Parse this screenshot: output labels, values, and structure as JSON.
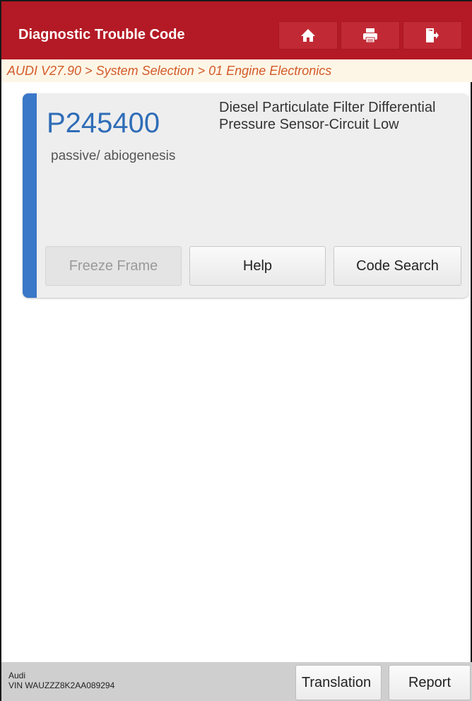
{
  "header": {
    "title": "Diagnostic Trouble Code",
    "buttons": [
      {
        "icon": "home-icon"
      },
      {
        "icon": "print-icon"
      },
      {
        "icon": "exit-icon"
      }
    ],
    "colors": {
      "bar": "#b41a25",
      "button": "#c12a35"
    }
  },
  "breadcrumb": {
    "text": "AUDI V27.90 > System Selection > 01 Engine Electronics"
  },
  "dtc": {
    "code": "P245400",
    "status": "passive/ abiogenesis",
    "description": "Diesel Particulate Filter Differential Pressure Sensor-Circuit Low",
    "accent_color": "#3a78c8",
    "buttons": {
      "freeze_frame": "Freeze Frame",
      "help": "Help",
      "code_search": "Code Search"
    }
  },
  "footer": {
    "vehicle_make": "Audi",
    "vin": "VIN WAUZZZ8K2AA089294",
    "translation": "Translation",
    "report": "Report"
  }
}
